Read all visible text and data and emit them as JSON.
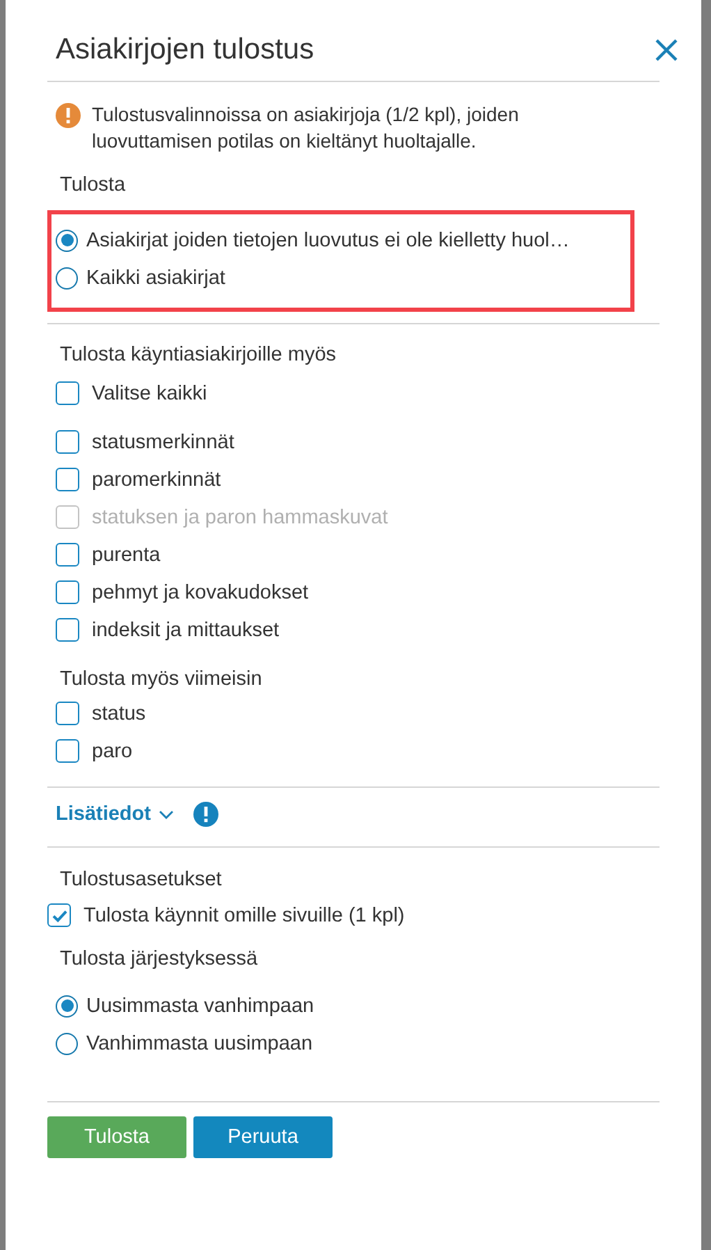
{
  "dialog": {
    "title": "Asiakirjojen tulostus",
    "warning": "Tulostusvalinnoissa on asiakirjoja (1/2 kpl), joiden luovuttamisen potilas on kieltänyt huoltajalle.",
    "print_label": "Tulosta",
    "print_options": [
      {
        "label": "Asiakirjat joiden tietojen luovutus ei ole kielletty huol…",
        "selected": true
      },
      {
        "label": "Kaikki asiakirjat",
        "selected": false
      }
    ],
    "visit_label": "Tulosta käyntiasiakirjoille myös",
    "select_all": {
      "label": "Valitse kaikki",
      "checked": false
    },
    "visit_items": [
      {
        "label": "statusmerkinnät",
        "checked": false,
        "disabled": false
      },
      {
        "label": "paromerkinnät",
        "checked": false,
        "disabled": false
      },
      {
        "label": "statuksen ja paron hammaskuvat",
        "checked": false,
        "disabled": true
      },
      {
        "label": "purenta",
        "checked": false,
        "disabled": false
      },
      {
        "label": "pehmyt ja kovakudokset",
        "checked": false,
        "disabled": false
      },
      {
        "label": "indeksit ja mittaukset",
        "checked": false,
        "disabled": false
      }
    ],
    "latest_label": "Tulosta myös viimeisin",
    "latest_items": [
      {
        "label": "status",
        "checked": false
      },
      {
        "label": "paro",
        "checked": false
      }
    ],
    "more_info": {
      "label": "Lisätiedot",
      "expanded": false
    },
    "settings_label": "Tulostusasetukset",
    "settings_items": [
      {
        "label": "Tulosta käynnit omille sivuille (1 kpl)",
        "checked": true
      }
    ],
    "order_label": "Tulosta järjestyksessä",
    "order_options": [
      {
        "label": "Uusimmasta vanhimpaan",
        "selected": true
      },
      {
        "label": "Vanhimmasta uusimpaan",
        "selected": false
      }
    ],
    "buttons": [
      {
        "label": "Tulosta",
        "kind": "primary"
      },
      {
        "label": "Peruuta",
        "kind": "secondary"
      }
    ]
  }
}
